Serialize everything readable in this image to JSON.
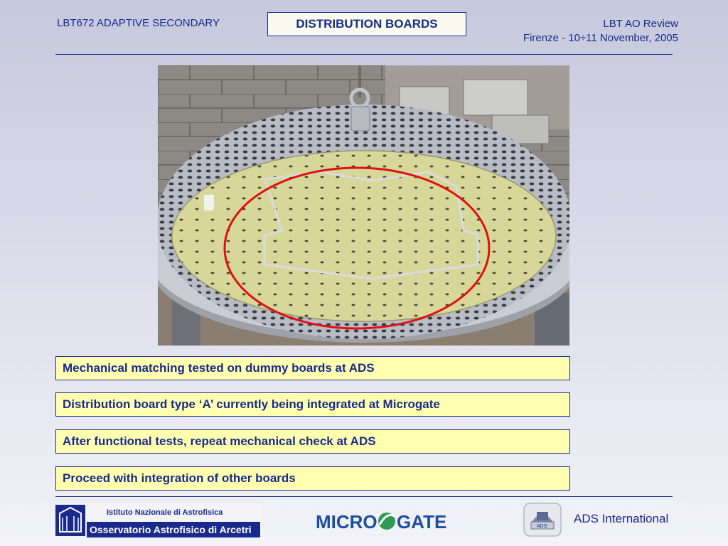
{
  "header": {
    "left": "LBT672 ADAPTIVE SECONDARY",
    "title": "DISTRIBUTION BOARDS",
    "right_line1": "LBT AO Review",
    "right_line2": "Firenze - 10÷11 November, 2005"
  },
  "photo": {
    "subject": "mirror-disk-with-distribution-boards"
  },
  "bullets": [
    "Mechanical matching tested on dummy boards at ADS",
    "Distribution board type ‘A’ currently being integrated at Microgate",
    "After functional tests, repeat mechanical check at ADS",
    "Proceed with integration of other boards"
  ],
  "footer": {
    "inaf_line1": "Istituto Nazionale di Astrofisica",
    "inaf_line2": "Osservatorio Astrofisico di Arcetri",
    "microgate_left": "MICRO",
    "microgate_right": "GATE",
    "ads_badge": "ADS",
    "ads_name": "ADS International"
  },
  "colors": {
    "text_primary": "#1a2a8c",
    "bullet_background": "#ffffb0",
    "highlight_circle": "#e01010",
    "microgate_blue": "#1d4fa0",
    "microgate_green": "#2e9a55"
  }
}
